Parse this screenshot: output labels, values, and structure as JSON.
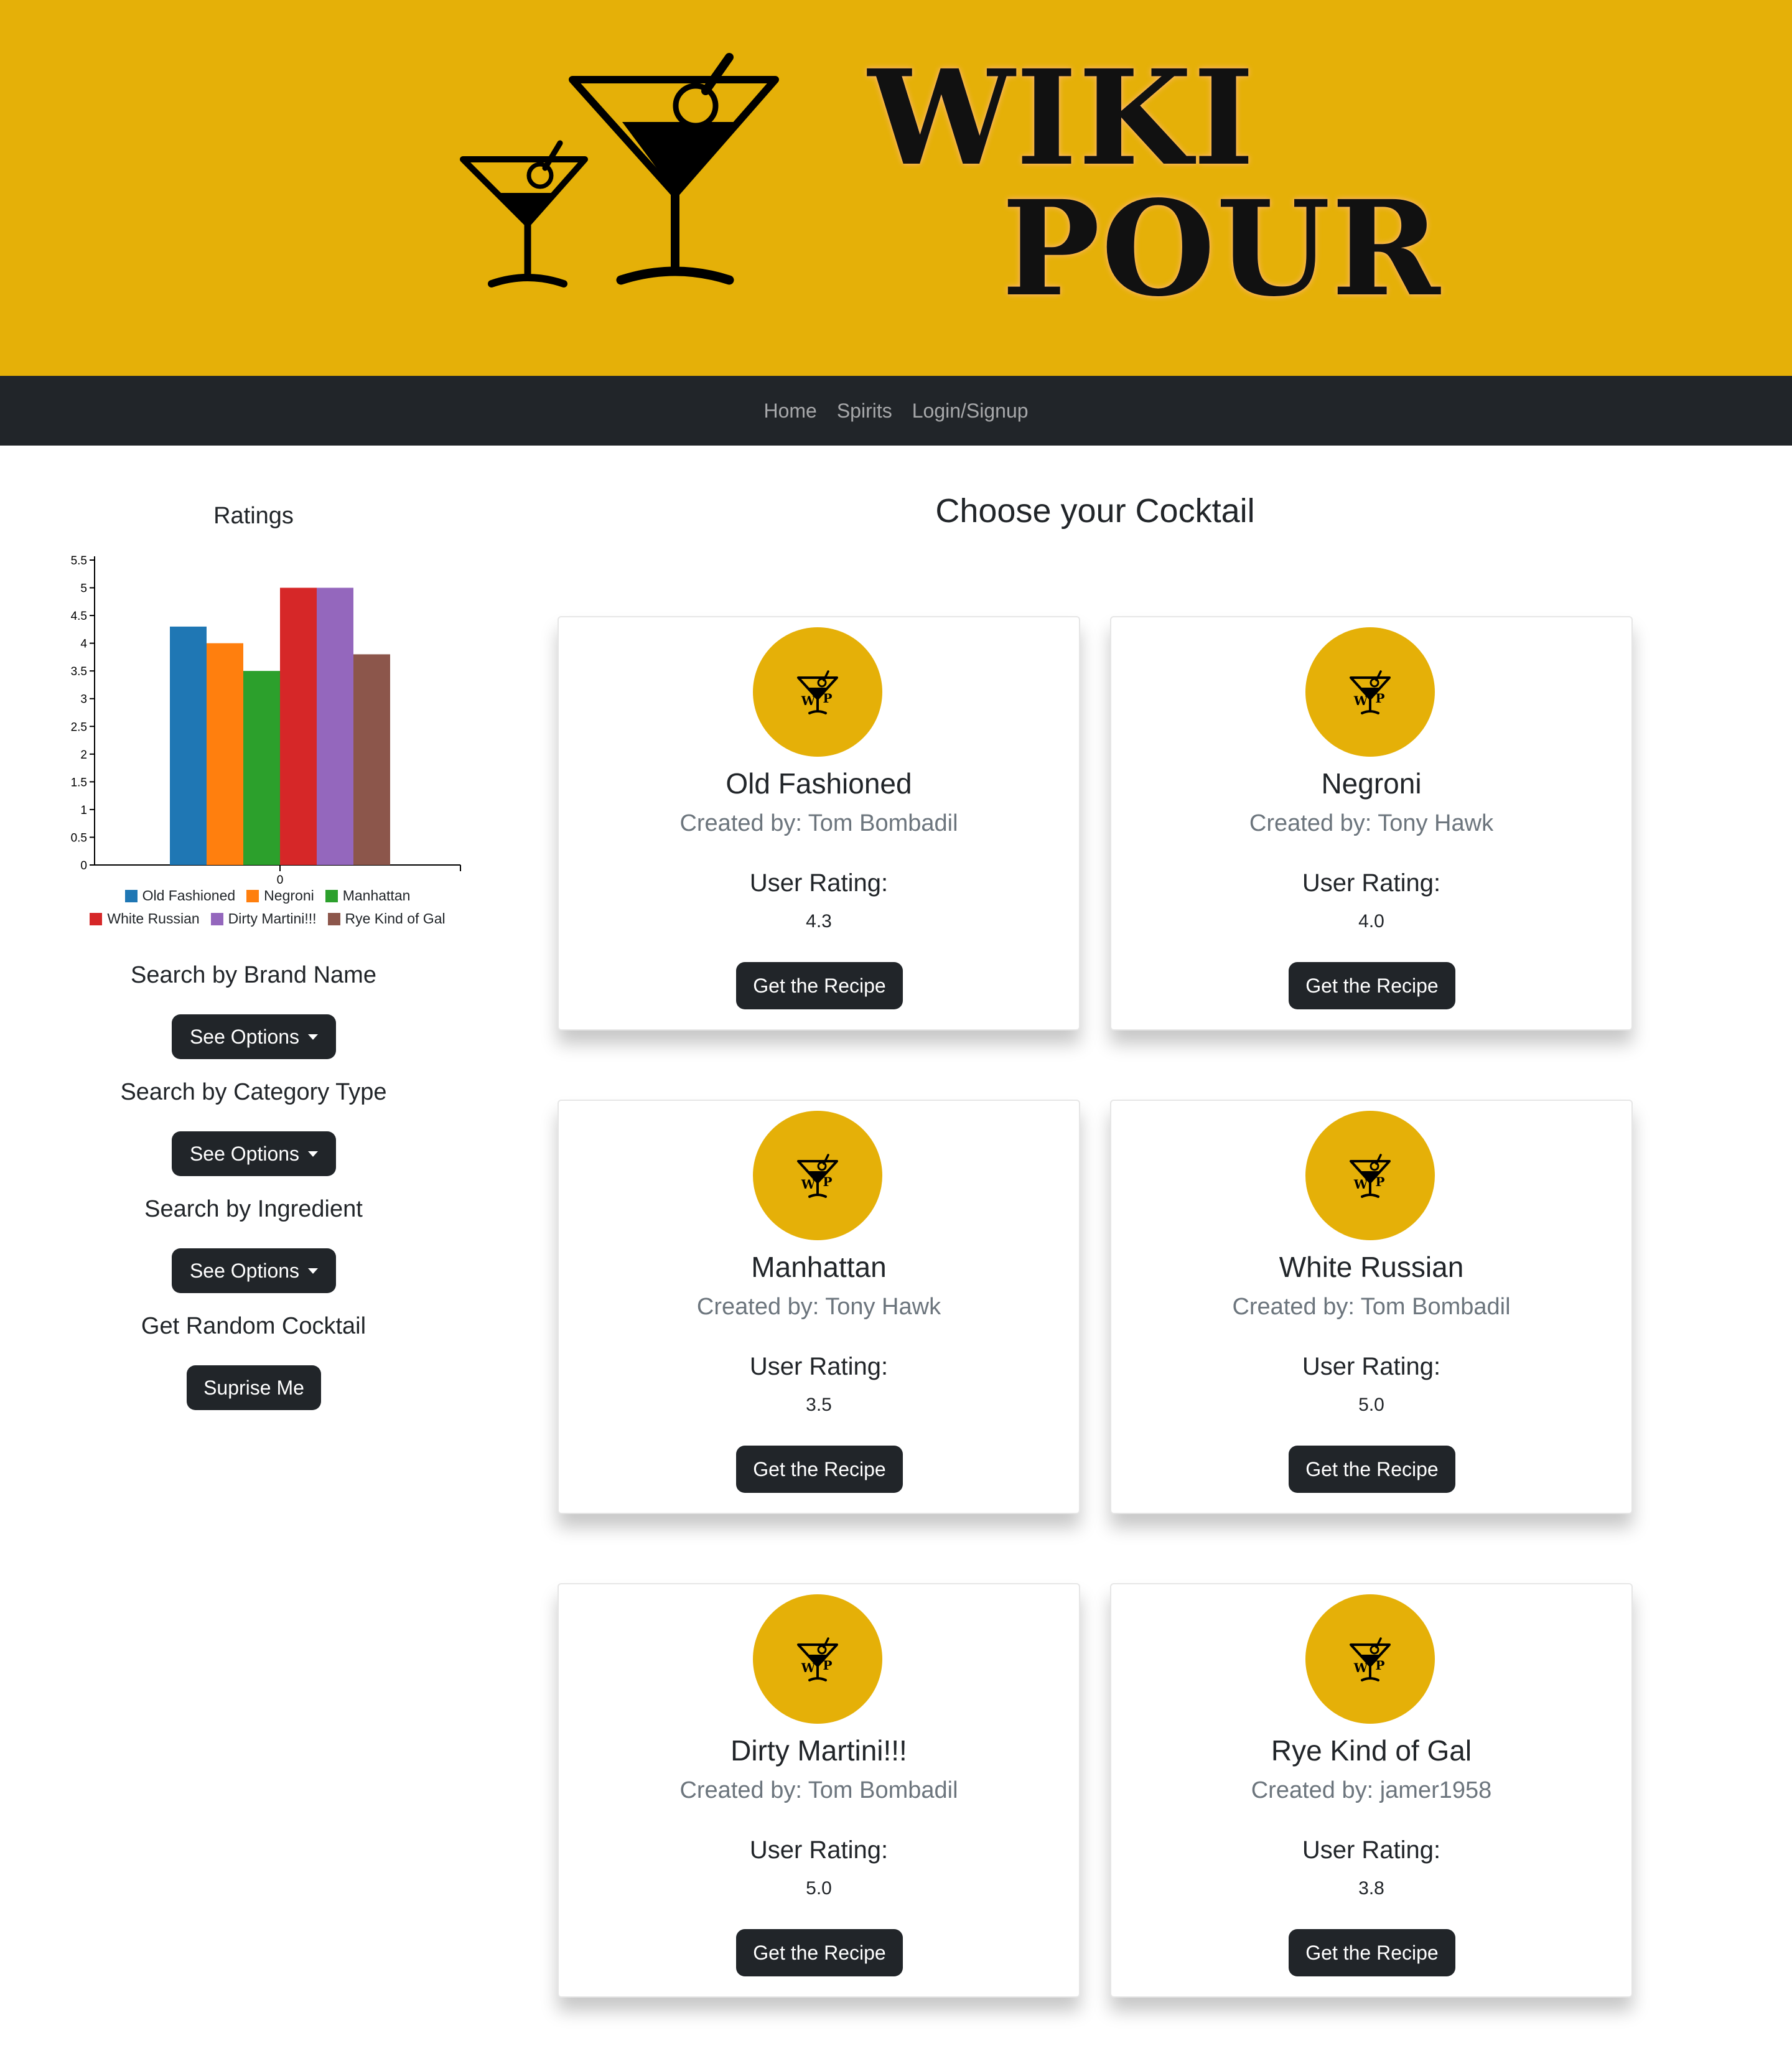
{
  "brand": {
    "line1": "WIKI",
    "line2": "POUR"
  },
  "nav": {
    "items": [
      "Home",
      "Spirits",
      "Login/Signup"
    ]
  },
  "sidebar": {
    "search_brand_label": "Search by Brand Name",
    "search_category_label": "Search by Category Type",
    "search_ingredient_label": "Search by Ingredient",
    "random_label": "Get Random Cocktail",
    "options_button": "See Options",
    "surprise_button": "Suprise Me"
  },
  "chart_data": {
    "type": "bar",
    "title": "Ratings",
    "categories": [
      "0"
    ],
    "series": [
      {
        "name": "Old Fashioned",
        "values": [
          4.3
        ],
        "color": "#1f77b4"
      },
      {
        "name": "Negroni",
        "values": [
          4.0
        ],
        "color": "#ff7f0e"
      },
      {
        "name": "Manhattan",
        "values": [
          3.5
        ],
        "color": "#2ca02c"
      },
      {
        "name": "White Russian",
        "values": [
          5.0
        ],
        "color": "#d62728"
      },
      {
        "name": "Dirty Martini!!!",
        "values": [
          5.0
        ],
        "color": "#9467bd"
      },
      {
        "name": "Rye Kind of Gal",
        "values": [
          3.8
        ],
        "color": "#8c564b"
      }
    ],
    "ylim": [
      0,
      5.5
    ],
    "yticks": [
      "0",
      "0.5",
      "1",
      "1.5",
      "2",
      "2.5",
      "3",
      "3.5",
      "4",
      "4.5",
      "5",
      "5.5"
    ],
    "grid": false,
    "legend": "bottom"
  },
  "main": {
    "title": "Choose your Cocktail",
    "rating_label": "User Rating:",
    "recipe_button": "Get the Recipe",
    "logo_initials": [
      "W",
      "P"
    ],
    "cocktails": [
      {
        "name": "Old Fashioned",
        "creator": "Created by: Tom Bombadil",
        "rating": "4.3"
      },
      {
        "name": "Negroni",
        "creator": "Created by: Tony Hawk",
        "rating": "4.0"
      },
      {
        "name": "Manhattan",
        "creator": "Created by: Tony Hawk",
        "rating": "3.5"
      },
      {
        "name": "White Russian",
        "creator": "Created by: Tom Bombadil",
        "rating": "5.0"
      },
      {
        "name": "Dirty Martini!!!",
        "creator": "Created by: Tom Bombadil",
        "rating": "5.0"
      },
      {
        "name": "Rye Kind of Gal",
        "creator": "Created by: jamer1958",
        "rating": "3.8"
      }
    ]
  },
  "colors": {
    "brand_gold": "#e5b008",
    "nav_dark": "#212529",
    "muted_text": "#6c757d"
  }
}
